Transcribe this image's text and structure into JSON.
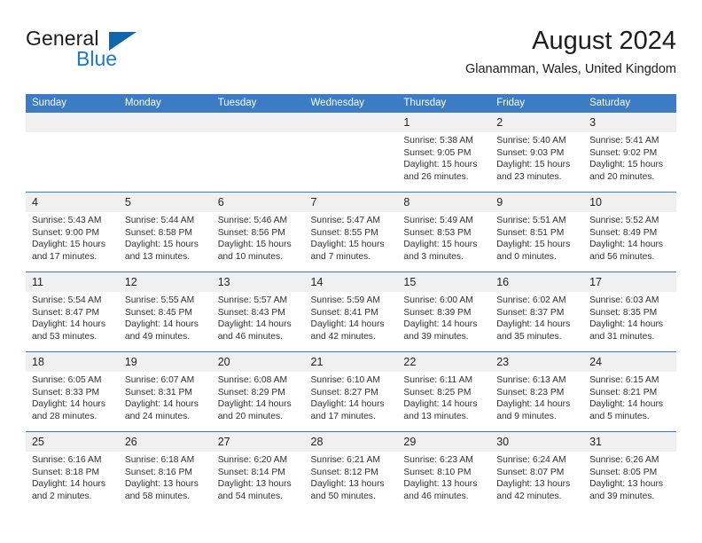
{
  "logo": {
    "word_one": "General",
    "word_two": "Blue",
    "icon": "triangle-icon"
  },
  "header": {
    "title": "August 2024",
    "location": "Glanamman, Wales, United Kingdom"
  },
  "colors": {
    "header_blue": "#3b7cc4",
    "logo_blue": "#2079c4",
    "daynum_band": "#f0f0f0"
  },
  "weekdays": [
    "Sunday",
    "Monday",
    "Tuesday",
    "Wednesday",
    "Thursday",
    "Friday",
    "Saturday"
  ],
  "labels": {
    "sunrise": "Sunrise:",
    "sunset": "Sunset:",
    "daylight": "Daylight:"
  },
  "weeks": [
    [
      {
        "day": "",
        "empty": true,
        "sunrise": "",
        "sunset": "",
        "daylight_a": "",
        "daylight_b": ""
      },
      {
        "day": "",
        "empty": true,
        "sunrise": "",
        "sunset": "",
        "daylight_a": "",
        "daylight_b": ""
      },
      {
        "day": "",
        "empty": true,
        "sunrise": "",
        "sunset": "",
        "daylight_a": "",
        "daylight_b": ""
      },
      {
        "day": "",
        "empty": true,
        "sunrise": "",
        "sunset": "",
        "daylight_a": "",
        "daylight_b": ""
      },
      {
        "day": "1",
        "empty": false,
        "sunrise": "Sunrise: 5:38 AM",
        "sunset": "Sunset: 9:05 PM",
        "daylight_a": "Daylight: 15 hours",
        "daylight_b": "and 26 minutes."
      },
      {
        "day": "2",
        "empty": false,
        "sunrise": "Sunrise: 5:40 AM",
        "sunset": "Sunset: 9:03 PM",
        "daylight_a": "Daylight: 15 hours",
        "daylight_b": "and 23 minutes."
      },
      {
        "day": "3",
        "empty": false,
        "sunrise": "Sunrise: 5:41 AM",
        "sunset": "Sunset: 9:02 PM",
        "daylight_a": "Daylight: 15 hours",
        "daylight_b": "and 20 minutes."
      }
    ],
    [
      {
        "day": "4",
        "empty": false,
        "sunrise": "Sunrise: 5:43 AM",
        "sunset": "Sunset: 9:00 PM",
        "daylight_a": "Daylight: 15 hours",
        "daylight_b": "and 17 minutes."
      },
      {
        "day": "5",
        "empty": false,
        "sunrise": "Sunrise: 5:44 AM",
        "sunset": "Sunset: 8:58 PM",
        "daylight_a": "Daylight: 15 hours",
        "daylight_b": "and 13 minutes."
      },
      {
        "day": "6",
        "empty": false,
        "sunrise": "Sunrise: 5:46 AM",
        "sunset": "Sunset: 8:56 PM",
        "daylight_a": "Daylight: 15 hours",
        "daylight_b": "and 10 minutes."
      },
      {
        "day": "7",
        "empty": false,
        "sunrise": "Sunrise: 5:47 AM",
        "sunset": "Sunset: 8:55 PM",
        "daylight_a": "Daylight: 15 hours",
        "daylight_b": "and 7 minutes."
      },
      {
        "day": "8",
        "empty": false,
        "sunrise": "Sunrise: 5:49 AM",
        "sunset": "Sunset: 8:53 PM",
        "daylight_a": "Daylight: 15 hours",
        "daylight_b": "and 3 minutes."
      },
      {
        "day": "9",
        "empty": false,
        "sunrise": "Sunrise: 5:51 AM",
        "sunset": "Sunset: 8:51 PM",
        "daylight_a": "Daylight: 15 hours",
        "daylight_b": "and 0 minutes."
      },
      {
        "day": "10",
        "empty": false,
        "sunrise": "Sunrise: 5:52 AM",
        "sunset": "Sunset: 8:49 PM",
        "daylight_a": "Daylight: 14 hours",
        "daylight_b": "and 56 minutes."
      }
    ],
    [
      {
        "day": "11",
        "empty": false,
        "sunrise": "Sunrise: 5:54 AM",
        "sunset": "Sunset: 8:47 PM",
        "daylight_a": "Daylight: 14 hours",
        "daylight_b": "and 53 minutes."
      },
      {
        "day": "12",
        "empty": false,
        "sunrise": "Sunrise: 5:55 AM",
        "sunset": "Sunset: 8:45 PM",
        "daylight_a": "Daylight: 14 hours",
        "daylight_b": "and 49 minutes."
      },
      {
        "day": "13",
        "empty": false,
        "sunrise": "Sunrise: 5:57 AM",
        "sunset": "Sunset: 8:43 PM",
        "daylight_a": "Daylight: 14 hours",
        "daylight_b": "and 46 minutes."
      },
      {
        "day": "14",
        "empty": false,
        "sunrise": "Sunrise: 5:59 AM",
        "sunset": "Sunset: 8:41 PM",
        "daylight_a": "Daylight: 14 hours",
        "daylight_b": "and 42 minutes."
      },
      {
        "day": "15",
        "empty": false,
        "sunrise": "Sunrise: 6:00 AM",
        "sunset": "Sunset: 8:39 PM",
        "daylight_a": "Daylight: 14 hours",
        "daylight_b": "and 39 minutes."
      },
      {
        "day": "16",
        "empty": false,
        "sunrise": "Sunrise: 6:02 AM",
        "sunset": "Sunset: 8:37 PM",
        "daylight_a": "Daylight: 14 hours",
        "daylight_b": "and 35 minutes."
      },
      {
        "day": "17",
        "empty": false,
        "sunrise": "Sunrise: 6:03 AM",
        "sunset": "Sunset: 8:35 PM",
        "daylight_a": "Daylight: 14 hours",
        "daylight_b": "and 31 minutes."
      }
    ],
    [
      {
        "day": "18",
        "empty": false,
        "sunrise": "Sunrise: 6:05 AM",
        "sunset": "Sunset: 8:33 PM",
        "daylight_a": "Daylight: 14 hours",
        "daylight_b": "and 28 minutes."
      },
      {
        "day": "19",
        "empty": false,
        "sunrise": "Sunrise: 6:07 AM",
        "sunset": "Sunset: 8:31 PM",
        "daylight_a": "Daylight: 14 hours",
        "daylight_b": "and 24 minutes."
      },
      {
        "day": "20",
        "empty": false,
        "sunrise": "Sunrise: 6:08 AM",
        "sunset": "Sunset: 8:29 PM",
        "daylight_a": "Daylight: 14 hours",
        "daylight_b": "and 20 minutes."
      },
      {
        "day": "21",
        "empty": false,
        "sunrise": "Sunrise: 6:10 AM",
        "sunset": "Sunset: 8:27 PM",
        "daylight_a": "Daylight: 14 hours",
        "daylight_b": "and 17 minutes."
      },
      {
        "day": "22",
        "empty": false,
        "sunrise": "Sunrise: 6:11 AM",
        "sunset": "Sunset: 8:25 PM",
        "daylight_a": "Daylight: 14 hours",
        "daylight_b": "and 13 minutes."
      },
      {
        "day": "23",
        "empty": false,
        "sunrise": "Sunrise: 6:13 AM",
        "sunset": "Sunset: 8:23 PM",
        "daylight_a": "Daylight: 14 hours",
        "daylight_b": "and 9 minutes."
      },
      {
        "day": "24",
        "empty": false,
        "sunrise": "Sunrise: 6:15 AM",
        "sunset": "Sunset: 8:21 PM",
        "daylight_a": "Daylight: 14 hours",
        "daylight_b": "and 5 minutes."
      }
    ],
    [
      {
        "day": "25",
        "empty": false,
        "sunrise": "Sunrise: 6:16 AM",
        "sunset": "Sunset: 8:18 PM",
        "daylight_a": "Daylight: 14 hours",
        "daylight_b": "and 2 minutes."
      },
      {
        "day": "26",
        "empty": false,
        "sunrise": "Sunrise: 6:18 AM",
        "sunset": "Sunset: 8:16 PM",
        "daylight_a": "Daylight: 13 hours",
        "daylight_b": "and 58 minutes."
      },
      {
        "day": "27",
        "empty": false,
        "sunrise": "Sunrise: 6:20 AM",
        "sunset": "Sunset: 8:14 PM",
        "daylight_a": "Daylight: 13 hours",
        "daylight_b": "and 54 minutes."
      },
      {
        "day": "28",
        "empty": false,
        "sunrise": "Sunrise: 6:21 AM",
        "sunset": "Sunset: 8:12 PM",
        "daylight_a": "Daylight: 13 hours",
        "daylight_b": "and 50 minutes."
      },
      {
        "day": "29",
        "empty": false,
        "sunrise": "Sunrise: 6:23 AM",
        "sunset": "Sunset: 8:10 PM",
        "daylight_a": "Daylight: 13 hours",
        "daylight_b": "and 46 minutes."
      },
      {
        "day": "30",
        "empty": false,
        "sunrise": "Sunrise: 6:24 AM",
        "sunset": "Sunset: 8:07 PM",
        "daylight_a": "Daylight: 13 hours",
        "daylight_b": "and 42 minutes."
      },
      {
        "day": "31",
        "empty": false,
        "sunrise": "Sunrise: 6:26 AM",
        "sunset": "Sunset: 8:05 PM",
        "daylight_a": "Daylight: 13 hours",
        "daylight_b": "and 39 minutes."
      }
    ]
  ]
}
